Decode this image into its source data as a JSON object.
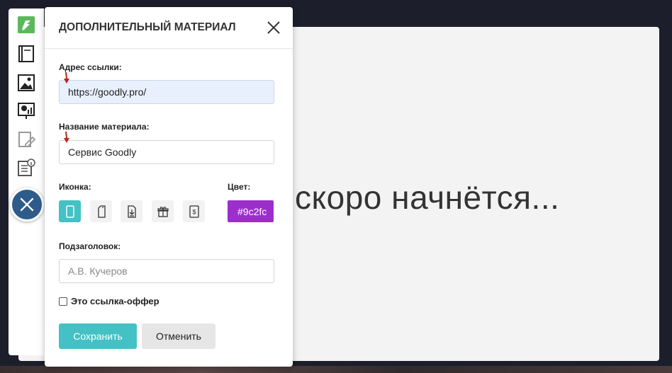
{
  "stage": {
    "text": "скоро начнётся..."
  },
  "toolbar": {
    "items": [
      {
        "icon": "logo-icon"
      },
      {
        "icon": "notebook-icon"
      },
      {
        "icon": "image-icon"
      },
      {
        "icon": "presentation-icon"
      },
      {
        "icon": "edit-materials-icon"
      },
      {
        "icon": "document-info-icon"
      }
    ],
    "close_icon": "close-icon"
  },
  "modal": {
    "title": "ДОПОЛНИТЕЛЬНЫЙ МАТЕРИАЛ",
    "link": {
      "label": "Адрес ссылки:",
      "value": "https://goodly.pro/"
    },
    "name": {
      "label": "Название материала:",
      "value": "Сервис Goodly"
    },
    "icon_label": "Иконка:",
    "icons": [
      "phone-icon",
      "tablet-icon",
      "document-download-icon",
      "gift-icon",
      "dollar-note-icon"
    ],
    "color_label": "Цвет:",
    "color_value": "#9c2fcc",
    "color_text": "#9c2fc",
    "subtitle": {
      "label": "Подзаголовок:",
      "placeholder": "А.В. Кучеров",
      "value": ""
    },
    "offer_checkbox": {
      "label": "Это ссылка-оффер",
      "checked": false
    },
    "save_label": "Сохранить",
    "cancel_label": "Отменить"
  },
  "colors": {
    "accent": "#44c1c4",
    "fab": "#2e5c8a",
    "marker": "#b3261e"
  }
}
